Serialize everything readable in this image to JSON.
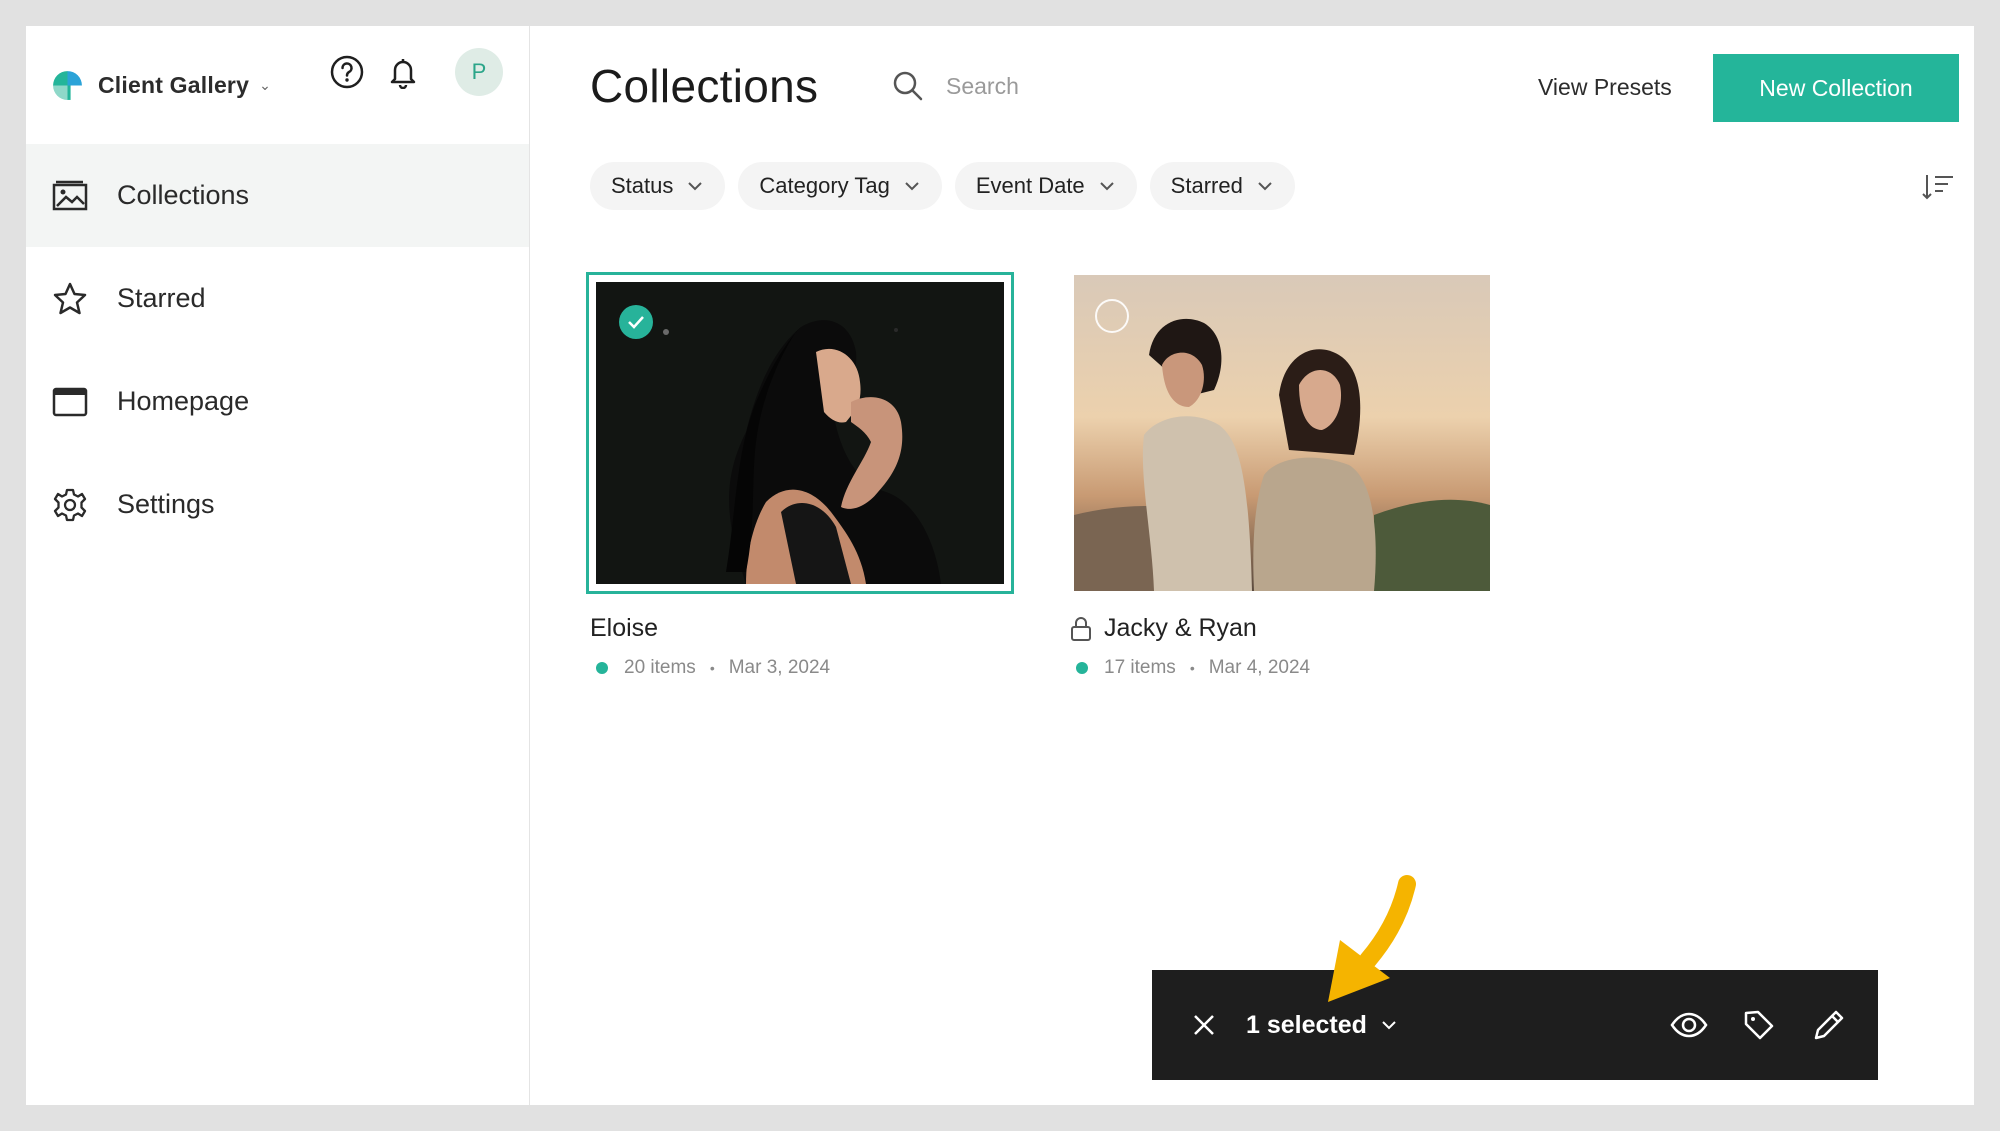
{
  "brand": {
    "name": "Client Gallery",
    "caret": "⌄"
  },
  "user": {
    "avatar_initial": "P"
  },
  "sidebar": {
    "items": [
      {
        "label": "Collections",
        "icon": "image-icon",
        "active": true
      },
      {
        "label": "Starred",
        "icon": "star-icon",
        "active": false
      },
      {
        "label": "Homepage",
        "icon": "browser-window-icon",
        "active": false
      },
      {
        "label": "Settings",
        "icon": "gear-icon",
        "active": false
      }
    ]
  },
  "header": {
    "title": "Collections",
    "search_placeholder": "Search",
    "view_presets": "View Presets",
    "new_collection": "New Collection"
  },
  "filters": [
    "Status",
    "Category Tag",
    "Event Date",
    "Starred"
  ],
  "collections": [
    {
      "title": "Eloise",
      "items": "20 items",
      "date": "Mar 3, 2024",
      "selected": true,
      "locked": false,
      "status_color": "#25b49a"
    },
    {
      "title": "Jacky & Ryan",
      "items": "17 items",
      "date": "Mar 4, 2024",
      "selected": false,
      "locked": true,
      "status_color": "#25b49a"
    }
  ],
  "action_bar": {
    "selected_label": "1 selected",
    "icons": [
      "eye-icon",
      "tag-icon",
      "pencil-icon"
    ]
  },
  "colors": {
    "accent": "#24b59a",
    "action_bar_bg": "#1e1e1e",
    "pointer": "#f5b400"
  }
}
